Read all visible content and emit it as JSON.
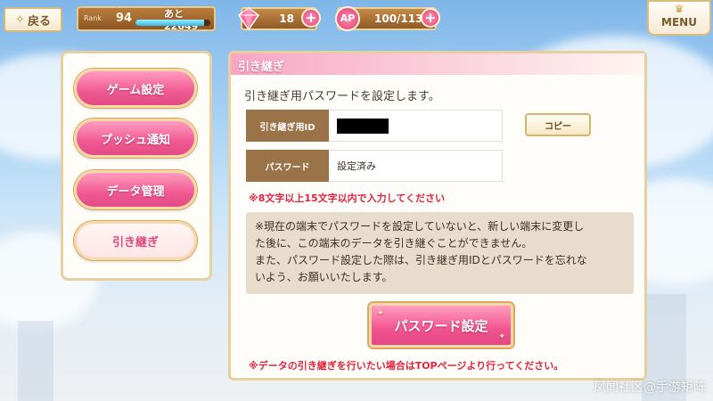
{
  "topbar": {
    "back_label": "戻る",
    "rank_label": "Rank",
    "rank_value": "94",
    "rank_next": "あと22649",
    "rank_progress": 0.92,
    "gems": "18",
    "ap_badge": "AP",
    "ap_value": "100/113",
    "menu_label": "MENU"
  },
  "sidebar": {
    "items": [
      {
        "label": "ゲーム設定"
      },
      {
        "label": "プッシュ通知"
      },
      {
        "label": "データ管理"
      },
      {
        "label": "引き継ぎ",
        "active": true
      }
    ]
  },
  "main": {
    "header_title": "引き継ぎ",
    "description": "引き継ぎ用パスワードを設定します。",
    "id_label": "引き継ぎ用ID",
    "copy_label": "コピー",
    "password_label": "パスワード",
    "password_value": "設定済み",
    "length_note": "※8文字以上15文字以内で入力してください",
    "info_lines": [
      "※現在の端末でパスワードを設定していないと、新しい端末に変更し",
      "た後に、この端末のデータを引き継ぐことができません。",
      "また、パスワード設定した際は、引き継ぎ用IDとパスワードを忘れな",
      "いよう、お願いいたします。"
    ],
    "set_password_button": "パスワード設定",
    "bottom_note": "※データの引き継ぎを行いたい場合はTOPページより行ってください。"
  },
  "watermark": "凤闻社区@手游矩阵",
  "colors": {
    "accent_pink": "#f05a92",
    "panel_gold": "#e8cf9e",
    "label_brown": "#9b7349",
    "warning_red": "#e0243d"
  }
}
